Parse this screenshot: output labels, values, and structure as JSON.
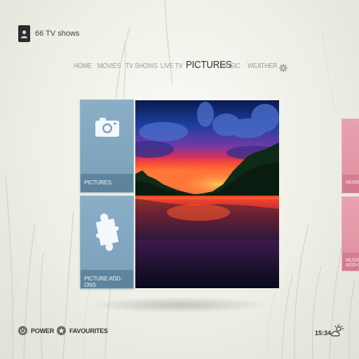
{
  "profile": {
    "label": "66 TV shows"
  },
  "menu": {
    "items": [
      {
        "label": "HOME"
      },
      {
        "label": "MOVIES"
      },
      {
        "label": "TV SHOWS"
      },
      {
        "label": "LIVE TV"
      },
      {
        "label": "PICTURES",
        "active": true
      },
      {
        "label": "MUSIC"
      },
      {
        "label": "WEATHER"
      }
    ],
    "settings_icon": "gear-icon"
  },
  "tiles": {
    "pictures": {
      "label": "PICTURES",
      "icon": "camera-icon"
    },
    "picture_addons": {
      "label": "PICTURE ADD-ONS",
      "icon": "puzzle-icon"
    },
    "music": {
      "label": "MUSIC"
    },
    "music_addons": {
      "label": "MUSIC ADD-ONS"
    }
  },
  "footer": {
    "power_label": "POWER",
    "favourites_label": "FAVOURITES",
    "clock": "15:34",
    "weather_icon": "sun-cloud-icon"
  },
  "colors": {
    "tile_blue": "#7fa5bf",
    "tile_pink": "#e39aa8",
    "text_dark": "#333333",
    "text_muted": "#9a9a9a"
  }
}
